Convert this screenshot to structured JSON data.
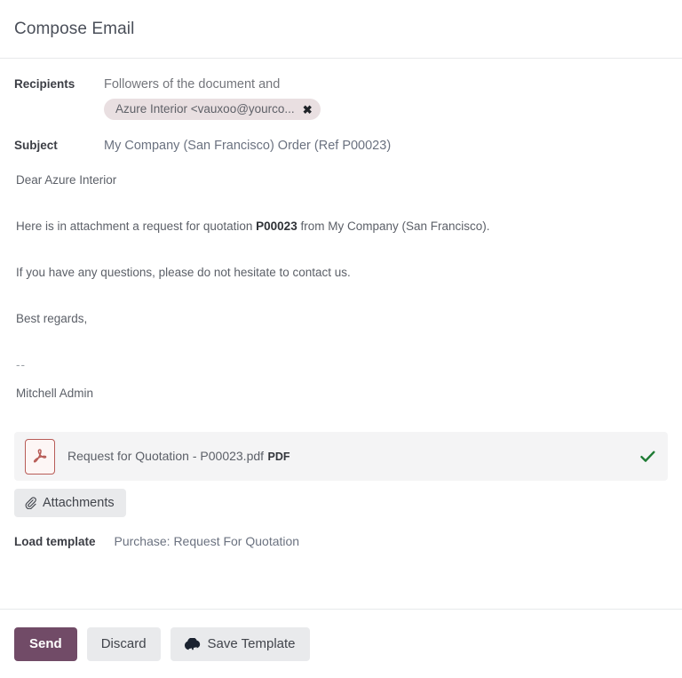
{
  "dialog": {
    "title": "Compose Email"
  },
  "fields": {
    "recipients": {
      "label": "Recipients",
      "value": "Followers of the document and",
      "tag": {
        "text": "Azure Interior  <vauxoo@yourco...",
        "remove_icon": "close-icon"
      }
    },
    "subject": {
      "label": "Subject",
      "value": "My Company (San Francisco) Order (Ref P00023)"
    }
  },
  "mail_body": {
    "greeting": "Dear Azure Interior",
    "line1_before": "Here is in attachment a request for quotation ",
    "line1_bold": "P00023",
    "line1_after": " from My Company (San Francisco).",
    "line2": "If you have any questions, please do not hesitate to contact us.",
    "line3": "Best regards,",
    "signature_separator": "--",
    "signature_name": "Mitchell Admin"
  },
  "attachment": {
    "name": "Request for Quotation - P00023.pdf",
    "type": "PDF",
    "icon": "pdf-file-icon",
    "status_icon": "check-icon"
  },
  "attachments_button": {
    "label": "Attachments",
    "icon": "paperclip-icon"
  },
  "load_template": {
    "label": "Load template",
    "value": "Purchase: Request For Quotation"
  },
  "footer": {
    "send_label": "Send",
    "discard_label": "Discard",
    "save_template_label": "Save Template",
    "save_template_icon": "cloud-upload-icon"
  },
  "colors": {
    "primary": "#714b67",
    "tag_background": "#e9dfe1",
    "secondary_button": "#e9eaec",
    "attachment_card": "#f4f4f5",
    "pdf_red": "#b85c57",
    "check_green": "#1e7b34"
  }
}
